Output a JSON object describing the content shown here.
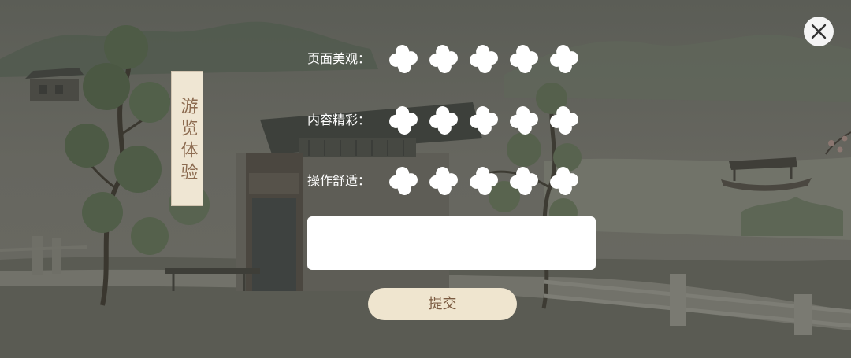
{
  "dialog": {
    "title": "游览体验",
    "close": {
      "icon": "close-icon"
    },
    "ratings": [
      {
        "label": "页面美观：",
        "icon": "flower-icon",
        "count": 5
      },
      {
        "label": "内容精彩：",
        "icon": "flower-icon",
        "count": 5
      },
      {
        "label": "操作舒适：",
        "icon": "flower-icon",
        "count": 5
      }
    ],
    "comment": {
      "value": "",
      "placeholder": ""
    },
    "submit_label": "提交"
  },
  "colors": {
    "panel_bg": "#efe6d3",
    "title_text": "#8c6b50",
    "label_text": "#ffffff",
    "icon_fill": "#ffffff",
    "input_bg": "#ffffff",
    "submit_bg": "#efe5cf",
    "submit_text": "#7c5c42",
    "close_bg": "#f4f4f4",
    "close_icon": "#333333"
  }
}
